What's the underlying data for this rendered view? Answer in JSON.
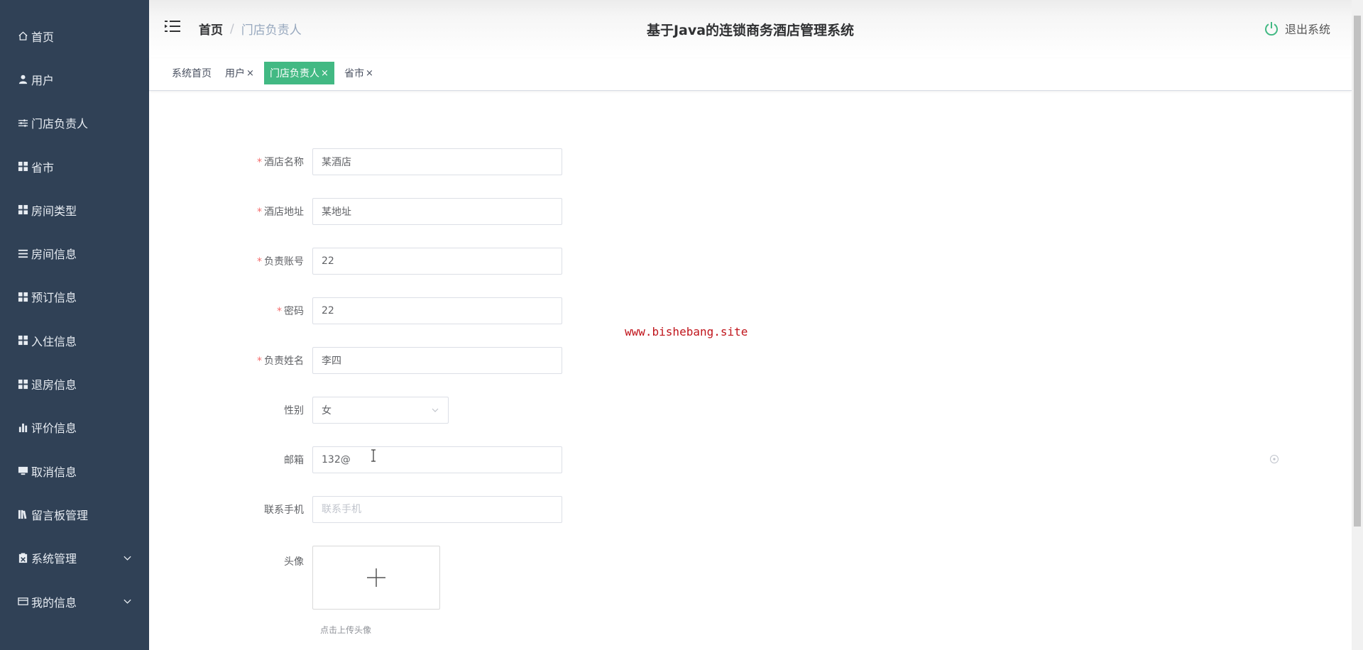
{
  "sidebar": {
    "items": [
      {
        "label": "首页",
        "icon": "home-icon",
        "has_children": false
      },
      {
        "label": "用户",
        "icon": "user-icon",
        "has_children": false
      },
      {
        "label": "门店负责人",
        "icon": "sliders-icon",
        "has_children": false
      },
      {
        "label": "省市",
        "icon": "grid-icon",
        "has_children": false
      },
      {
        "label": "房间类型",
        "icon": "grid-icon",
        "has_children": false
      },
      {
        "label": "房间信息",
        "icon": "list-icon",
        "has_children": false
      },
      {
        "label": "预订信息",
        "icon": "grid-icon",
        "has_children": false
      },
      {
        "label": "入住信息",
        "icon": "grid-icon",
        "has_children": false
      },
      {
        "label": "退房信息",
        "icon": "grid-icon",
        "has_children": false
      },
      {
        "label": "评价信息",
        "icon": "bar-chart-icon",
        "has_children": false
      },
      {
        "label": "取消信息",
        "icon": "monitor-icon",
        "has_children": false
      },
      {
        "label": "留言板管理",
        "icon": "books-icon",
        "has_children": false
      },
      {
        "label": "系统管理",
        "icon": "settings-box-icon",
        "has_children": true
      },
      {
        "label": "我的信息",
        "icon": "card-icon",
        "has_children": true
      }
    ]
  },
  "header": {
    "breadcrumb_home": "首页",
    "breadcrumb_separator": "/",
    "breadcrumb_current": "门店负责人",
    "title": "基于Java的连锁商务酒店管理系统",
    "logout_label": "退出系统"
  },
  "tags": [
    {
      "label": "系统首页",
      "closable": false,
      "active": false
    },
    {
      "label": "用户",
      "closable": true,
      "active": false
    },
    {
      "label": "门店负责人",
      "closable": true,
      "active": true
    },
    {
      "label": "省市",
      "closable": true,
      "active": false
    }
  ],
  "tag_close_glyph": "×",
  "form": {
    "hotel_name": {
      "label": "酒店名称",
      "required": "*",
      "value": "某酒店"
    },
    "hotel_address": {
      "label": "酒店地址",
      "required": "*",
      "value": "某地址"
    },
    "account": {
      "label": "负责账号",
      "required": "*",
      "value": "22"
    },
    "password": {
      "label": "密码",
      "required": "*",
      "value": "22"
    },
    "manager_name": {
      "label": "负责姓名",
      "required": "*",
      "value": "李四"
    },
    "gender": {
      "label": "性别",
      "value": "女"
    },
    "email": {
      "label": "邮箱",
      "value": "132@"
    },
    "phone": {
      "label": "联系手机",
      "value": "",
      "placeholder": "联系手机"
    },
    "avatar": {
      "label": "头像",
      "tip": "点击上传头像"
    }
  },
  "watermark": "www.bishebang.site",
  "colors": {
    "sidebar_bg": "#304156",
    "active_tag": "#42b983",
    "required": "#f56c6c",
    "watermark": "#c0141b"
  }
}
